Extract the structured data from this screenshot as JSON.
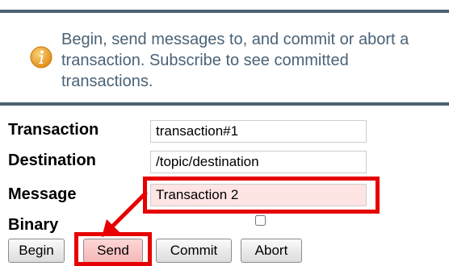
{
  "info": {
    "icon": "info-icon",
    "accent_color": "#f0a830",
    "text": "Begin, send messages to, and commit or abort a transaction. Subscribe to see committed transactions."
  },
  "form": {
    "transaction_label": "Transaction",
    "transaction_value": "transaction#1",
    "destination_label": "Destination",
    "destination_value": "/topic/destination",
    "message_label": "Message",
    "message_value": "Transaction 2",
    "binary_label": "Binary",
    "binary_checked": false
  },
  "buttons": {
    "begin": "Begin",
    "send": "Send",
    "commit": "Commit",
    "abort": "Abort"
  },
  "annotation_color": "#e60000"
}
